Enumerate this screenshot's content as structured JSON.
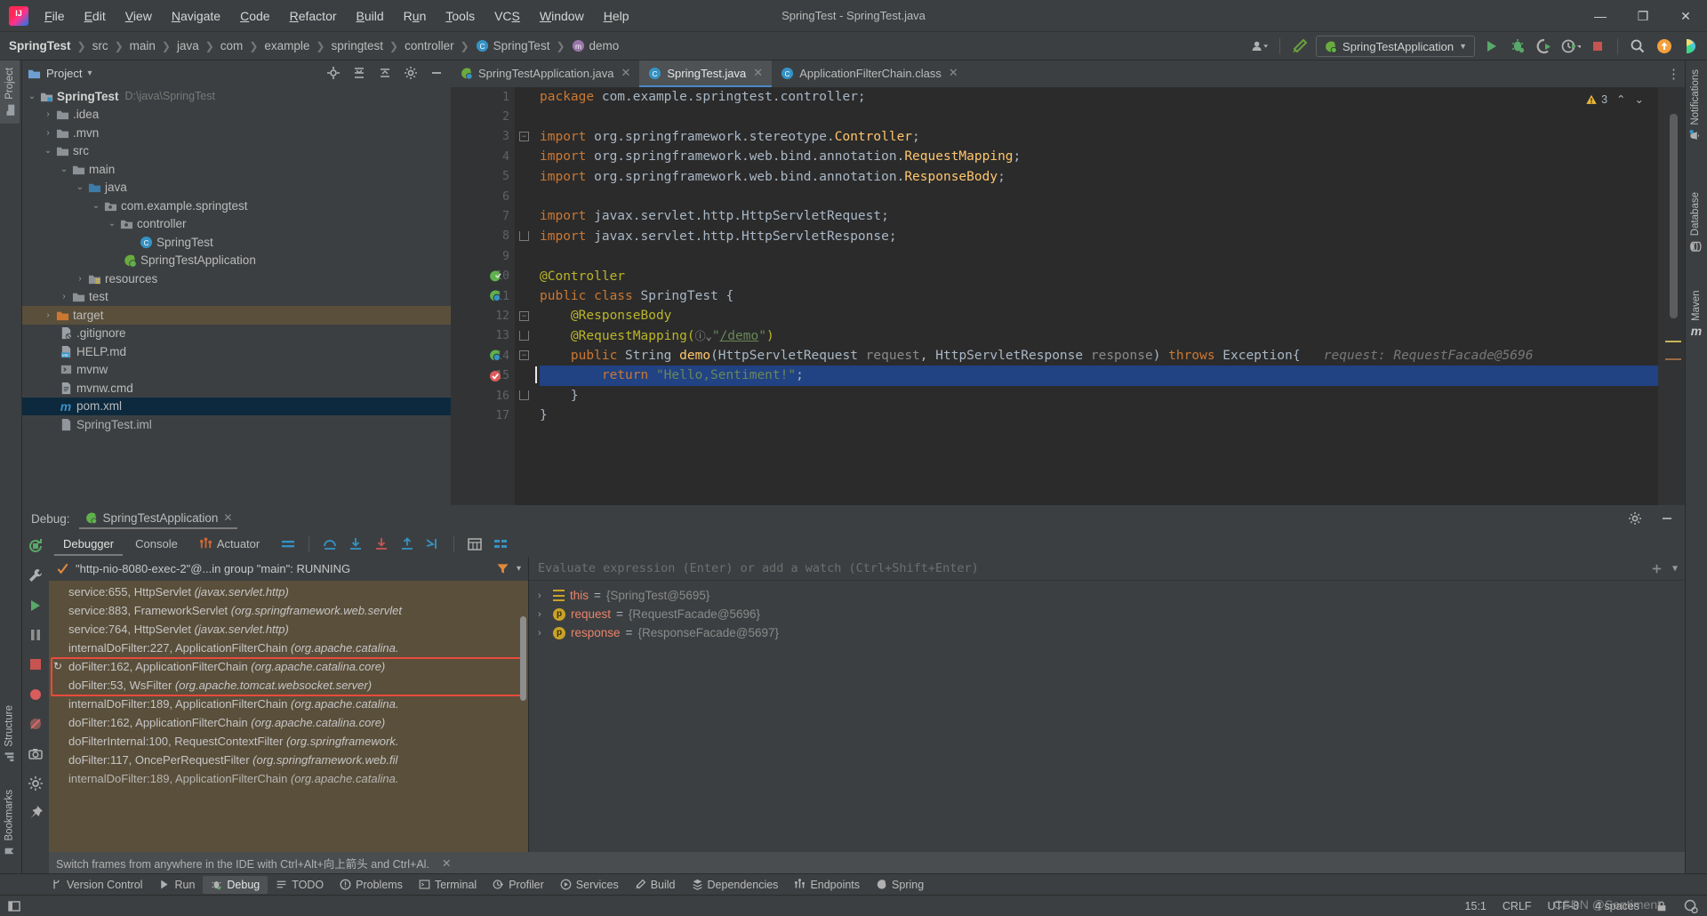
{
  "window": {
    "title": "SpringTest - SpringTest.java",
    "app_icon": "intellij-idea-logo",
    "minimize": "—",
    "maximize": "❐",
    "close": "✕"
  },
  "menubar": {
    "items": [
      {
        "label": "File",
        "mnemonic": "F"
      },
      {
        "label": "Edit",
        "mnemonic": "E"
      },
      {
        "label": "View",
        "mnemonic": "V"
      },
      {
        "label": "Navigate",
        "mnemonic": "N"
      },
      {
        "label": "Code",
        "mnemonic": "C"
      },
      {
        "label": "Refactor",
        "mnemonic": "R"
      },
      {
        "label": "Build",
        "mnemonic": "B"
      },
      {
        "label": "Run",
        "mnemonic": "u"
      },
      {
        "label": "Tools",
        "mnemonic": "T"
      },
      {
        "label": "VCS",
        "mnemonic": "S"
      },
      {
        "label": "Window",
        "mnemonic": "W"
      },
      {
        "label": "Help",
        "mnemonic": "H"
      }
    ]
  },
  "breadcrumb": {
    "items": [
      {
        "label": "SpringTest",
        "bold": true
      },
      {
        "label": "src",
        "bold": false
      },
      {
        "label": "main",
        "bold": false
      },
      {
        "label": "java",
        "bold": false
      },
      {
        "label": "com",
        "bold": false
      },
      {
        "label": "example",
        "bold": false
      },
      {
        "label": "springtest",
        "bold": false
      },
      {
        "label": "controller",
        "bold": false
      },
      {
        "label": "SpringTest",
        "bold": false,
        "icon": "class-icon"
      },
      {
        "label": "demo",
        "bold": false,
        "icon": "method-icon"
      }
    ],
    "separator": "❯"
  },
  "toolbar": {
    "run_config": "SpringTestApplication",
    "icons": [
      "user-account-icon",
      "build-hammer-icon",
      "run-icon",
      "debug-icon",
      "run-coverage-icon",
      "profiler-icon",
      "stop-icon",
      "search-everywhere-icon",
      "updates-icon",
      "ai-assistant-icon"
    ]
  },
  "left_tool_strip": {
    "top": [
      {
        "label": "Project",
        "icon": "project-folder-icon",
        "active": true
      }
    ],
    "bottom": [
      {
        "label": "Structure",
        "icon": "structure-icon"
      },
      {
        "label": "Bookmarks",
        "icon": "bookmark-icon"
      }
    ]
  },
  "right_tool_strip": {
    "items": [
      {
        "label": "Notifications",
        "icon": "bell-icon"
      },
      {
        "label": "Database",
        "icon": "database-icon"
      },
      {
        "label": "Maven",
        "icon": "maven-icon"
      }
    ]
  },
  "project_panel": {
    "title": "Project",
    "dropdown": "▾",
    "header_icons": [
      "locate-icon",
      "expand-all-icon",
      "collapse-all-icon",
      "settings-gear-icon",
      "hide-icon"
    ],
    "tree": [
      {
        "depth": 0,
        "twisty": "⌄",
        "icon": "module-folder-icon",
        "label": "SpringTest",
        "bold": true,
        "path": "D:\\java\\SpringTest",
        "state": "normal"
      },
      {
        "depth": 1,
        "twisty": "›",
        "icon": "folder-icon",
        "label": ".idea",
        "bold": false,
        "path": "",
        "state": "normal"
      },
      {
        "depth": 1,
        "twisty": "›",
        "icon": "folder-icon",
        "label": ".mvn",
        "bold": false,
        "path": "",
        "state": "normal"
      },
      {
        "depth": 1,
        "twisty": "⌄",
        "icon": "folder-icon",
        "label": "src",
        "bold": false,
        "path": "",
        "state": "normal"
      },
      {
        "depth": 2,
        "twisty": "⌄",
        "icon": "folder-icon",
        "label": "main",
        "bold": false,
        "path": "",
        "state": "normal"
      },
      {
        "depth": 3,
        "twisty": "⌄",
        "icon": "source-root-icon",
        "label": "java",
        "bold": false,
        "path": "",
        "state": "normal"
      },
      {
        "depth": 4,
        "twisty": "⌄",
        "icon": "package-icon",
        "label": "com.example.springtest",
        "bold": false,
        "path": "",
        "state": "normal"
      },
      {
        "depth": 5,
        "twisty": "⌄",
        "icon": "package-icon",
        "label": "controller",
        "bold": false,
        "path": "",
        "state": "normal"
      },
      {
        "depth": 6,
        "twisty": "",
        "icon": "java-class-icon",
        "label": "SpringTest",
        "bold": false,
        "path": "",
        "state": "normal"
      },
      {
        "depth": 5,
        "twisty": "",
        "icon": "spring-class-icon",
        "label": "SpringTestApplication",
        "bold": false,
        "path": "",
        "state": "normal"
      },
      {
        "depth": 3,
        "twisty": "›",
        "icon": "resources-folder-icon",
        "label": "resources",
        "bold": false,
        "path": "",
        "state": "normal"
      },
      {
        "depth": 2,
        "twisty": "›",
        "icon": "folder-icon",
        "label": "test",
        "bold": false,
        "path": "",
        "state": "normal"
      },
      {
        "depth": 1,
        "twisty": "›",
        "icon": "target-folder-icon",
        "label": "target",
        "bold": false,
        "path": "",
        "state": "selected-inactive"
      },
      {
        "depth": 1,
        "twisty": "",
        "icon": "gitignore-file-icon",
        "label": ".gitignore",
        "bold": false,
        "path": "",
        "state": "normal"
      },
      {
        "depth": 1,
        "twisty": "",
        "icon": "markdown-file-icon",
        "label": "HELP.md",
        "bold": false,
        "path": "",
        "state": "normal"
      },
      {
        "depth": 1,
        "twisty": "",
        "icon": "shell-script-icon",
        "label": "mvnw",
        "bold": false,
        "path": "",
        "state": "normal"
      },
      {
        "depth": 1,
        "twisty": "",
        "icon": "cmd-file-icon",
        "label": "mvnw.cmd",
        "bold": false,
        "path": "",
        "state": "normal"
      },
      {
        "depth": 1,
        "twisty": "",
        "icon": "maven-pom-icon",
        "label": "pom.xml",
        "bold": false,
        "path": "",
        "state": "selected"
      },
      {
        "depth": 1,
        "twisty": "",
        "icon": "iml-file-icon",
        "label": "SpringTest.iml",
        "bold": false,
        "path": "",
        "state": "normal"
      }
    ]
  },
  "editor": {
    "tabs": [
      {
        "label": "SpringTestApplication.java",
        "icon": "spring-class-icon",
        "active": false,
        "close": "✕"
      },
      {
        "label": "SpringTest.java",
        "icon": "java-class-icon",
        "active": true,
        "close": "✕"
      },
      {
        "label": "ApplicationFilterChain.class",
        "icon": "java-class-icon",
        "active": false,
        "close": "✕"
      }
    ],
    "more_icon": "⋮",
    "inspection_count": "3",
    "inspection_up": "⌃",
    "inspection_down": "⌄",
    "caret_position": "15:1",
    "lines": [
      {
        "num": "1",
        "gutter_mark": "",
        "fold": "",
        "highlight": false,
        "tokens": [
          {
            "t": "package ",
            "c": "kw"
          },
          {
            "t": "com.example.springtest.controller;",
            "c": "pln"
          }
        ]
      },
      {
        "num": "2",
        "gutter_mark": "",
        "fold": "",
        "highlight": false,
        "tokens": []
      },
      {
        "num": "3",
        "gutter_mark": "",
        "fold": "minus",
        "highlight": false,
        "tokens": [
          {
            "t": "import ",
            "c": "kw"
          },
          {
            "t": "org.springframework.stereotype.",
            "c": "pln"
          },
          {
            "t": "Controller",
            "c": "typ"
          },
          {
            "t": ";",
            "c": "pln"
          }
        ]
      },
      {
        "num": "4",
        "gutter_mark": "",
        "fold": "",
        "highlight": false,
        "tokens": [
          {
            "t": "import ",
            "c": "kw"
          },
          {
            "t": "org.springframework.web.bind.annotation.",
            "c": "pln"
          },
          {
            "t": "RequestMapping",
            "c": "typ"
          },
          {
            "t": ";",
            "c": "pln"
          }
        ]
      },
      {
        "num": "5",
        "gutter_mark": "",
        "fold": "",
        "highlight": false,
        "tokens": [
          {
            "t": "import ",
            "c": "kw"
          },
          {
            "t": "org.springframework.web.bind.annotation.",
            "c": "pln"
          },
          {
            "t": "ResponseBody",
            "c": "typ"
          },
          {
            "t": ";",
            "c": "pln"
          }
        ]
      },
      {
        "num": "6",
        "gutter_mark": "",
        "fold": "",
        "highlight": false,
        "tokens": []
      },
      {
        "num": "7",
        "gutter_mark": "",
        "fold": "",
        "highlight": false,
        "tokens": [
          {
            "t": "import ",
            "c": "kw"
          },
          {
            "t": "javax.servlet.http.HttpServletRequest;",
            "c": "pln"
          }
        ]
      },
      {
        "num": "8",
        "gutter_mark": "",
        "fold": "up",
        "highlight": false,
        "tokens": [
          {
            "t": "import ",
            "c": "kw"
          },
          {
            "t": "javax.servlet.http.HttpServletResponse;",
            "c": "pln"
          }
        ]
      },
      {
        "num": "9",
        "gutter_mark": "",
        "fold": "",
        "highlight": false,
        "tokens": []
      },
      {
        "num": "10",
        "gutter_mark": "spring-bean-icon",
        "fold": "",
        "highlight": false,
        "tokens": [
          {
            "t": "@Controller",
            "c": "ann"
          }
        ]
      },
      {
        "num": "11",
        "gutter_mark": "spring-bean-class-icon",
        "fold": "",
        "highlight": false,
        "tokens": [
          {
            "t": "public ",
            "c": "kw"
          },
          {
            "t": "class ",
            "c": "kw"
          },
          {
            "t": "SpringTest ",
            "c": "cls"
          },
          {
            "t": "{",
            "c": "pln"
          }
        ]
      },
      {
        "num": "12",
        "gutter_mark": "",
        "fold": "minus",
        "highlight": false,
        "tokens": [
          {
            "t": "    @ResponseBody",
            "c": "ann"
          }
        ]
      },
      {
        "num": "13",
        "gutter_mark": "",
        "fold": "up",
        "highlight": false,
        "tokens": [
          {
            "t": "    @RequestMapping(",
            "c": "ann"
          },
          {
            "t": "ⓘ⌄",
            "c": "pln"
          },
          {
            "t": "\"",
            "c": "str"
          },
          {
            "t": "/demo",
            "c": "link"
          },
          {
            "t": "\"",
            "c": "str"
          },
          {
            "t": ")",
            "c": "ann"
          }
        ]
      },
      {
        "num": "14",
        "gutter_mark": "spring-endpoint-icon",
        "fold": "minus",
        "highlight": false,
        "tokens": [
          {
            "t": "    public ",
            "c": "kw"
          },
          {
            "t": "String ",
            "c": "cls"
          },
          {
            "t": "demo",
            "c": "typ"
          },
          {
            "t": "(",
            "c": "pln"
          },
          {
            "t": "HttpServletRequest ",
            "c": "cls"
          },
          {
            "t": "request",
            "c": "param"
          },
          {
            "t": ", ",
            "c": "pln"
          },
          {
            "t": "HttpServletResponse ",
            "c": "cls"
          },
          {
            "t": "response",
            "c": "param"
          },
          {
            "t": ") ",
            "c": "pln"
          },
          {
            "t": "throws ",
            "c": "kw"
          },
          {
            "t": "Exception{",
            "c": "cls"
          },
          {
            "t": "   request: RequestFacade@5696",
            "c": "hint"
          }
        ]
      },
      {
        "num": "15",
        "gutter_mark": "breakpoint-hit-icon",
        "fold": "",
        "highlight": true,
        "tokens": [
          {
            "t": "        return ",
            "c": "kw"
          },
          {
            "t": "\"Hello,Sentiment!\"",
            "c": "str"
          },
          {
            "t": ";",
            "c": "pln"
          }
        ]
      },
      {
        "num": "16",
        "gutter_mark": "",
        "fold": "up",
        "highlight": false,
        "tokens": [
          {
            "t": "    }",
            "c": "pln"
          }
        ]
      },
      {
        "num": "17",
        "gutter_mark": "",
        "fold": "",
        "highlight": false,
        "tokens": [
          {
            "t": "}",
            "c": "pln"
          }
        ]
      }
    ]
  },
  "debug": {
    "label": "Debug:",
    "run_tab": "SpringTestApplication",
    "run_tab_close": "✕",
    "header_icons": [
      "settings-gear-icon",
      "hide-panel-icon"
    ],
    "tabs": [
      {
        "label": "Debugger",
        "active": true,
        "icon": ""
      },
      {
        "label": "Console",
        "active": false,
        "icon": ""
      },
      {
        "label": "Actuator",
        "active": false,
        "icon": "actuator-icon"
      }
    ],
    "toolbar_icons": [
      "show-execution-point-icon",
      "step-over-icon",
      "step-into-icon",
      "force-step-into-icon",
      "step-out-icon",
      "run-to-cursor-icon",
      "evaluate-expression-icon",
      "mute-breakpoints-icon"
    ],
    "rail_icons": [
      "rerun-icon",
      "settings-wrench-icon",
      "resume-icon",
      "pause-icon",
      "stop-icon",
      "view-breakpoints-icon",
      "mute-breakpoints-icon",
      "camera-icon",
      "settings-icon",
      "pin-icon"
    ],
    "thread": {
      "status_icon": "thread-running-check-icon",
      "label": "\"http-nio-8080-exec-2\"@...in group \"main\": RUNNING",
      "filter_icon": "filter-icon",
      "dropdown_icon": "▾"
    },
    "frames": [
      {
        "text": "service:655, HttpServlet ",
        "pkg": "(javax.servlet.http)",
        "current": false,
        "boxed": false
      },
      {
        "text": "service:883, FrameworkServlet ",
        "pkg": "(org.springframework.web.servlet",
        "current": false,
        "boxed": false
      },
      {
        "text": "service:764, HttpServlet ",
        "pkg": "(javax.servlet.http)",
        "current": false,
        "boxed": false
      },
      {
        "text": "internalDoFilter:227, ApplicationFilterChain ",
        "pkg": "(org.apache.catalina.",
        "current": false,
        "boxed": false
      },
      {
        "text": "doFilter:162, ApplicationFilterChain ",
        "pkg": "(org.apache.catalina.core)",
        "current": true,
        "boxed": true
      },
      {
        "text": "doFilter:53, WsFilter ",
        "pkg": "(org.apache.tomcat.websocket.server)",
        "current": false,
        "boxed": true
      },
      {
        "text": "internalDoFilter:189, ApplicationFilterChain ",
        "pkg": "(org.apache.catalina.",
        "current": false,
        "boxed": false
      },
      {
        "text": "doFilter:162, ApplicationFilterChain ",
        "pkg": "(org.apache.catalina.core)",
        "current": false,
        "boxed": false
      },
      {
        "text": "doFilterInternal:100, RequestContextFilter ",
        "pkg": "(org.springframework.",
        "current": false,
        "boxed": false
      },
      {
        "text": "doFilter:117, OncePerRequestFilter ",
        "pkg": "(org.springframework.web.fil",
        "current": false,
        "boxed": false
      },
      {
        "text": "internalDoFilter:189, ApplicationFilterChain ",
        "pkg": "(org.apache.catalina.",
        "current": false,
        "boxed": false
      }
    ],
    "evaluate_placeholder": "Evaluate expression (Enter) or add a watch (Ctrl+Shift+Enter)",
    "eval_icons": [
      "add-watch-icon",
      "▾"
    ],
    "variables": [
      {
        "arrow": "›",
        "badge": "this",
        "name": "this",
        "eq": " = ",
        "value": "{SpringTest@5695}"
      },
      {
        "arrow": "›",
        "badge": "p",
        "name": "request",
        "eq": " = ",
        "value": "{RequestFacade@5696}"
      },
      {
        "arrow": "›",
        "badge": "p",
        "name": "response",
        "eq": " = ",
        "value": "{ResponseFacade@5697}"
      }
    ],
    "hint": {
      "icon": "pin-icon",
      "text": "Switch frames from anywhere in the IDE with Ctrl+Alt+向上箭头 and Ctrl+Al.",
      "close": "✕"
    }
  },
  "tool_window_bar": {
    "items": [
      {
        "label": "Version Control",
        "icon": "branch-icon",
        "active": false
      },
      {
        "label": "Run",
        "icon": "run-icon",
        "active": false
      },
      {
        "label": "Debug",
        "icon": "debug-icon",
        "active": true
      },
      {
        "label": "TODO",
        "icon": "todo-icon",
        "active": false
      },
      {
        "label": "Problems",
        "icon": "problems-icon",
        "active": false
      },
      {
        "label": "Terminal",
        "icon": "terminal-icon",
        "active": false
      },
      {
        "label": "Profiler",
        "icon": "profiler-icon",
        "active": false
      },
      {
        "label": "Services",
        "icon": "services-icon",
        "active": false
      },
      {
        "label": "Build",
        "icon": "build-hammer-icon",
        "active": false
      },
      {
        "label": "Dependencies",
        "icon": "dependencies-icon",
        "active": false
      },
      {
        "label": "Endpoints",
        "icon": "endpoints-icon",
        "active": false
      },
      {
        "label": "Spring",
        "icon": "spring-leaf-icon",
        "active": false
      }
    ]
  },
  "statusbar": {
    "left_icon": "toggle-toolwindow-icon",
    "caret": "15:1",
    "line_separator": "CRLF",
    "encoding": "UTF-8",
    "indent": "4 spaces",
    "lock_icon": "read-only-lock-icon",
    "inspections_icon": "inspections-gear-icon"
  },
  "watermark": "CSDN @Sentiment",
  "colors": {
    "chrome_bg": "#3c3f41",
    "editor_bg": "#2b2b2b",
    "gutter_bg": "#313335",
    "selection_blue": "#214283",
    "frames_bg": "#5a4f3b",
    "accent_blue": "#4a88c7",
    "red_box": "#e94b3c",
    "keyword_orange": "#cc7832",
    "string_green": "#6a8759",
    "annotation_yellow": "#bbb529"
  }
}
